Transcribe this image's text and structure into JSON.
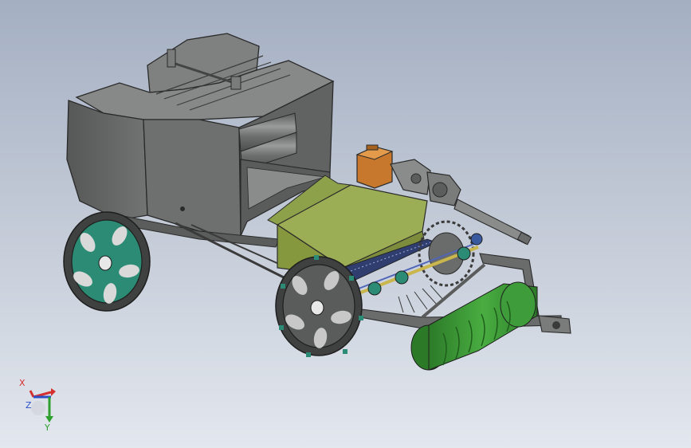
{
  "viewport": {
    "background_top": "#a4afc2",
    "background_bottom": "#e3e7ee"
  },
  "model": {
    "body_color": "#6e6f6f",
    "body_dark": "#4d4e4f",
    "body_light": "#8d8e8e",
    "hopper_color": "#9cae55",
    "hopper_dark": "#7c8c3c",
    "gearbox_color": "#c8782c",
    "wheel_hub_color": "#2c8b74",
    "roller_color": "#3f9c3a",
    "roller_dark": "#2c7a28"
  },
  "triad": {
    "x_label": "X",
    "y_label": "Y",
    "z_label": "Z",
    "x_color": "#d43030",
    "y_color": "#2ea02e",
    "z_color": "#2c4fc8"
  }
}
